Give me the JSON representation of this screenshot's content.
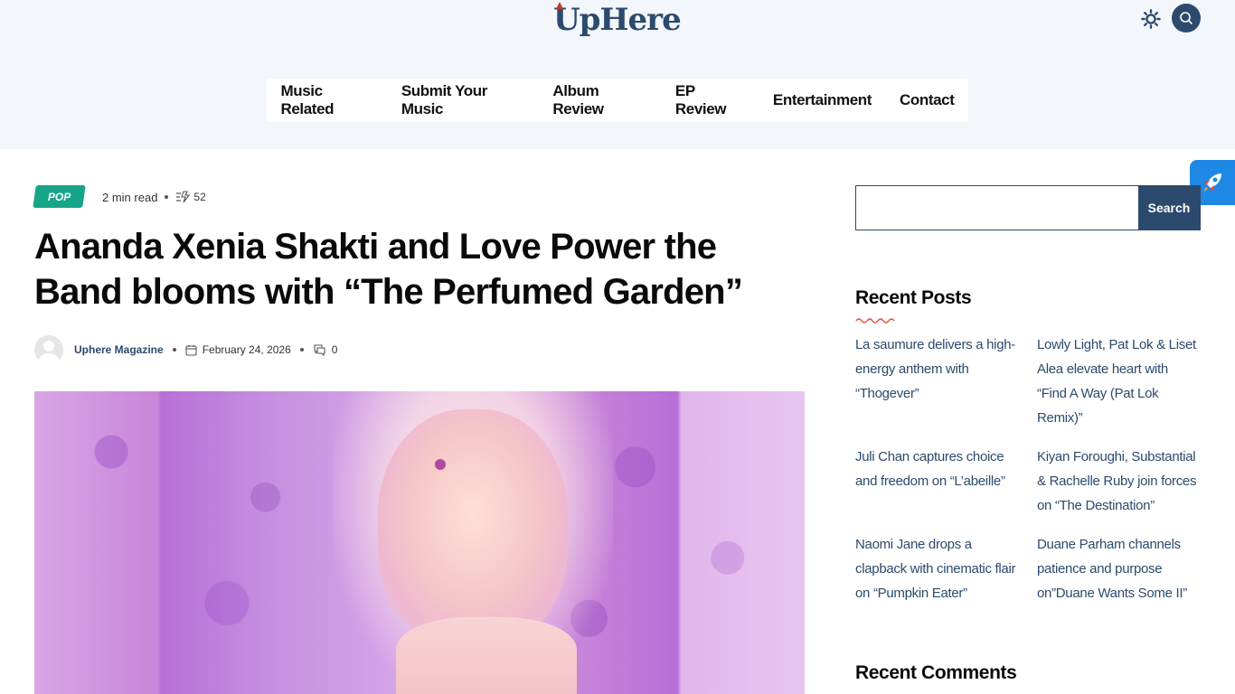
{
  "header": {
    "logo_text": "UpHere",
    "nav": [
      "Music Related",
      "Submit Your Music",
      "Album Review",
      "EP Review",
      "Entertainment",
      "Contact"
    ]
  },
  "article": {
    "category": "POP",
    "read_time": "2 min read",
    "views": "52",
    "title": "Ananda Xenia Shakti and Love Power the Band blooms with “The Perfumed Garden”",
    "author": "Uphere Magazine",
    "date": "February 24, 2026",
    "comments": "0"
  },
  "sidebar": {
    "search_button": "Search",
    "search_placeholder": "",
    "recent_posts_title": "Recent Posts",
    "recent_posts": [
      "La saumure delivers a high-energy anthem with “Thogever”",
      "Lowly Light, Pat Lok & Liset Alea elevate heart with “Find A Way (Pat Lok Remix)”",
      "Juli Chan captures choice and freedom on “L’abeille”",
      "Kiyan Foroughi, Substantial & Rachelle Ruby join forces on “The Destination”",
      "Naomi Jane drops a clapback with cinematic flair on “Pumpkin Eater”",
      "Duane Parham channels patience and purpose on”Duane Wants Some II”"
    ],
    "recent_comments_title": "Recent Comments"
  },
  "colors": {
    "brand": "#2c4a6e",
    "badge": "#17a589",
    "accent": "#e74c3c",
    "header_bg": "#f3f6fa"
  }
}
